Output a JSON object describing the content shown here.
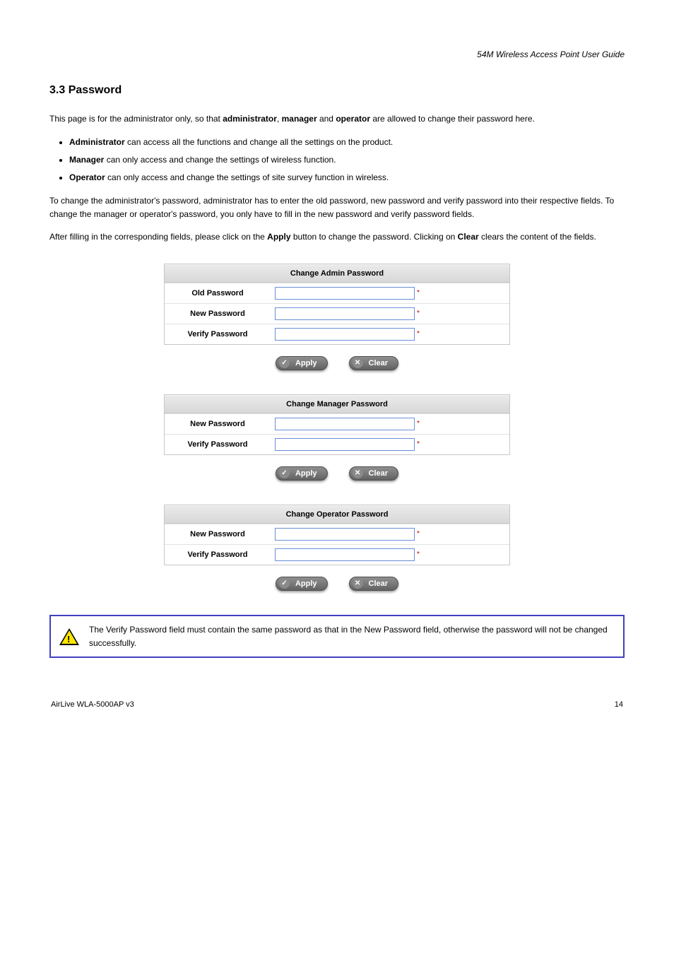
{
  "header": {
    "doc_title": "54M Wireless Access Point User Guide"
  },
  "section": {
    "heading": "3.3 Password",
    "para1_a": "This page is for the administrator only, so that ",
    "para1_b": "administrator",
    "para1_c": ", ",
    "para1_d": "manager",
    "para1_e": " and ",
    "para1_f": "operator",
    "para1_g": " are allowed to change their password here.",
    "bullet1_a": "Administrator",
    "bullet1_b": " can access all the functions and change all the settings on the product.",
    "bullet2_a": "Manager",
    "bullet2_b": " can only access and change the settings of wireless function.",
    "bullet3_a": "Operator",
    "bullet3_b": " can only access and change the settings of site survey function in wireless.",
    "para2": "To change the administrator's password, administrator has to enter the old password, new password and verify password into their respective fields. To change the manager or operator's password, you only have to fill in the new password and verify password fields.",
    "para3_a": "After filling in the corresponding fields, please click on the ",
    "para3_b": "Apply",
    "para3_c": " button to change the password. Clicking on ",
    "para3_d": "Clear",
    "para3_e": " clears the content of the fields."
  },
  "forms": {
    "admin": {
      "title": "Change Admin Password",
      "rows": [
        {
          "label": "Old Password",
          "req": "*"
        },
        {
          "label": "New Password",
          "req": "*"
        },
        {
          "label": "Verify Password",
          "req": "*"
        }
      ]
    },
    "manager": {
      "title": "Change Manager Password",
      "rows": [
        {
          "label": "New Password",
          "req": "*"
        },
        {
          "label": "Verify Password",
          "req": "*"
        }
      ]
    },
    "operator": {
      "title": "Change Operator Password",
      "rows": [
        {
          "label": "New Password",
          "req": "*"
        },
        {
          "label": "Verify Password",
          "req": "*"
        }
      ]
    },
    "buttons": {
      "apply": "Apply",
      "clear": "Clear"
    }
  },
  "caution": {
    "text": "The Verify Password field must contain the same password as that in the New Password field, otherwise the password will not be changed successfully."
  },
  "footer": {
    "company": "AirLive WLA-5000AP v3",
    "page": "14"
  }
}
